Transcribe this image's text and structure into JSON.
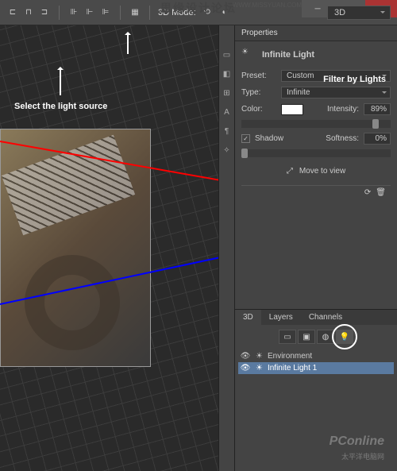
{
  "watermark_top": "思缘设计论坛",
  "watermark_url": "WWW.MISSYUAN.COM",
  "topbar": {
    "mode_label": "3D Mode:",
    "view_dd": "3D"
  },
  "properties": {
    "tab": "Properties",
    "title": "Infinite Light",
    "preset_label": "Preset:",
    "preset_value": "Custom",
    "type_label": "Type:",
    "type_value": "Infinite",
    "color_label": "Color:",
    "intensity_label": "Intensity:",
    "intensity_value": "89%",
    "shadow_label": "Shadow",
    "softness_label": "Softness:",
    "softness_value": "0%",
    "move_to_view": "Move to view"
  },
  "panel3d": {
    "tabs": [
      "3D",
      "Layers",
      "Channels"
    ],
    "environment": "Environment",
    "light1": "Infinite Light 1"
  },
  "annotations": {
    "filter_by_lights": "Filter by Lights",
    "select_source": "Select the light source"
  },
  "branding": {
    "logo": "PConline",
    "sub": "太平洋电脑网"
  }
}
